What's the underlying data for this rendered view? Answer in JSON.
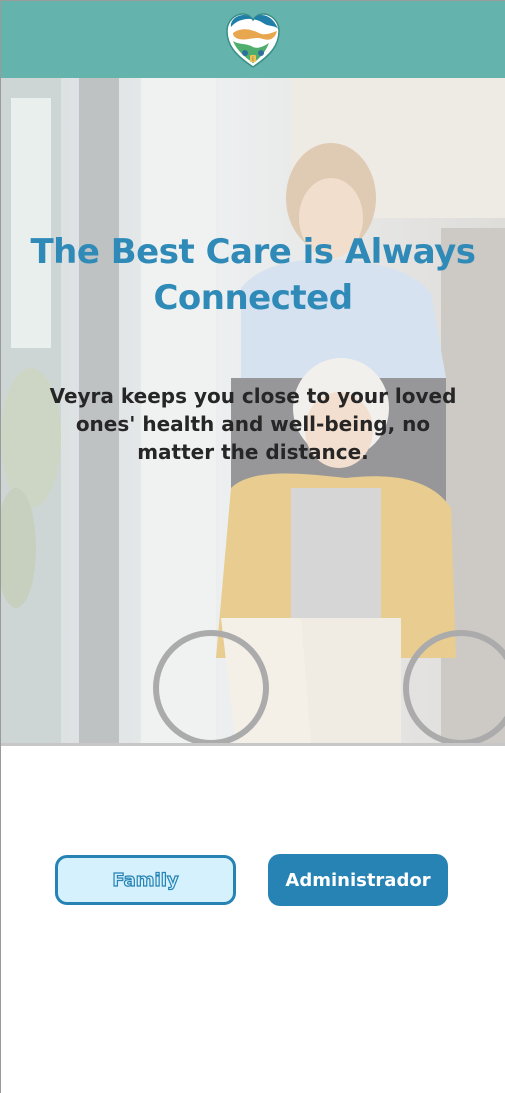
{
  "header": {
    "logo_icon": "veyra-logo-heart-icon"
  },
  "hero": {
    "title": "The Best Care is Always Connected",
    "subtitle": "Veyra keeps you close to your loved ones' health and well-being, no matter the distance.",
    "image": "caregiver-with-elderly-woman-in-wheelchair"
  },
  "actions": {
    "family_label": "Family",
    "admin_label": "Administrador"
  },
  "colors": {
    "header": "#64b3ac",
    "accent": "#2683b4",
    "family_bg": "#d4f1fd",
    "title": "#2f8ab8"
  }
}
